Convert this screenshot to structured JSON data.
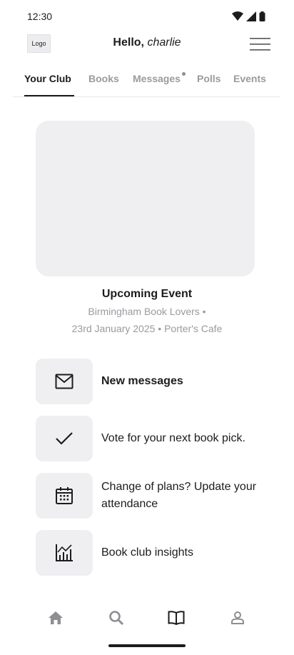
{
  "status": {
    "time": "12:30"
  },
  "header": {
    "logo": "Logo",
    "greeting": "Hello,",
    "user_name": "charlie"
  },
  "tabs": [
    {
      "label": "Your Club",
      "active": true
    },
    {
      "label": "Books",
      "active": false
    },
    {
      "label": "Messages",
      "active": false,
      "has_notification": true
    },
    {
      "label": "Polls",
      "active": false
    },
    {
      "label": "Events",
      "active": false
    }
  ],
  "event": {
    "title": "Upcoming Event",
    "club": "Birmingham Book Lovers •",
    "details": "23rd January 2025 • Porter's Cafe"
  },
  "actions": [
    {
      "icon": "mail-icon",
      "label": "New messages",
      "bold": true
    },
    {
      "icon": "check-icon",
      "label": "Vote for your next book pick.",
      "bold": false
    },
    {
      "icon": "calendar-icon",
      "label": "Change of plans? Update your attendance",
      "bold": false
    },
    {
      "icon": "chart-icon",
      "label": "Book club insights",
      "bold": false
    }
  ],
  "bottom_nav": [
    {
      "icon": "home-icon",
      "active": false
    },
    {
      "icon": "search-icon",
      "active": false
    },
    {
      "icon": "book-icon",
      "active": true
    },
    {
      "icon": "profile-icon",
      "active": false
    }
  ],
  "colors": {
    "text": "#1c1c1e",
    "muted": "#9a9aa0",
    "surface": "#efeff2",
    "icon_inactive": "#8e8e93"
  }
}
